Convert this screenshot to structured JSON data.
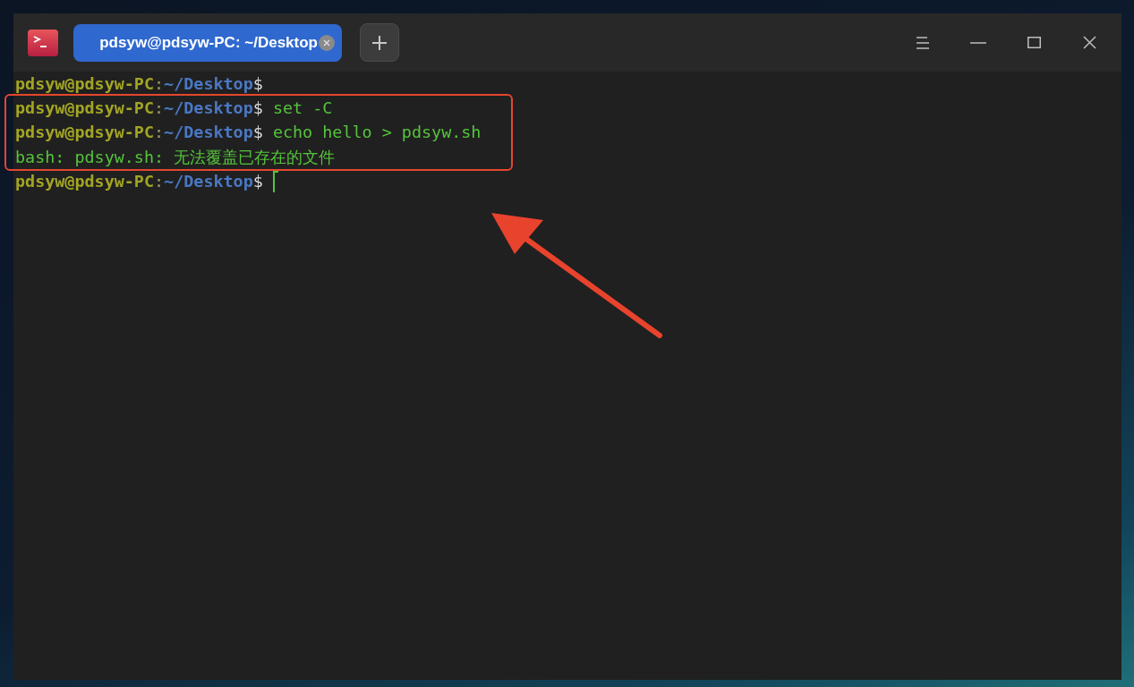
{
  "tabs": [
    {
      "label": "pdsyw@pdsyw-PC: ~/Desktop",
      "selected": true
    }
  ],
  "lines": [
    {
      "highlighted": false,
      "cursor": false,
      "segments": [
        {
          "kind": "user",
          "text": "pdsyw@pdsyw-PC"
        },
        {
          "kind": "sep",
          "text": ":"
        },
        {
          "kind": "path",
          "text": "~/Desktop"
        },
        {
          "kind": "sign",
          "text": "$"
        }
      ]
    },
    {
      "highlighted": true,
      "cursor": false,
      "segments": [
        {
          "kind": "user",
          "text": "pdsyw@pdsyw-PC"
        },
        {
          "kind": "sep",
          "text": ":"
        },
        {
          "kind": "path",
          "text": "~/Desktop"
        },
        {
          "kind": "sign",
          "text": "$"
        },
        {
          "kind": "command",
          "text": " set -C"
        }
      ]
    },
    {
      "highlighted": true,
      "cursor": false,
      "segments": [
        {
          "kind": "user",
          "text": "pdsyw@pdsyw-PC"
        },
        {
          "kind": "sep",
          "text": ":"
        },
        {
          "kind": "path",
          "text": "~/Desktop"
        },
        {
          "kind": "sign",
          "text": "$"
        },
        {
          "kind": "command",
          "text": " echo hello > pdsyw.sh"
        }
      ]
    },
    {
      "highlighted": true,
      "cursor": false,
      "segments": [
        {
          "kind": "output",
          "text": "bash: pdsyw.sh: 无法覆盖已存在的文件"
        }
      ]
    },
    {
      "highlighted": false,
      "cursor": true,
      "segments": [
        {
          "kind": "user",
          "text": "pdsyw@pdsyw-PC"
        },
        {
          "kind": "sep",
          "text": ":"
        },
        {
          "kind": "path",
          "text": "~/Desktop"
        },
        {
          "kind": "sign",
          "text": "$"
        }
      ]
    }
  ]
}
